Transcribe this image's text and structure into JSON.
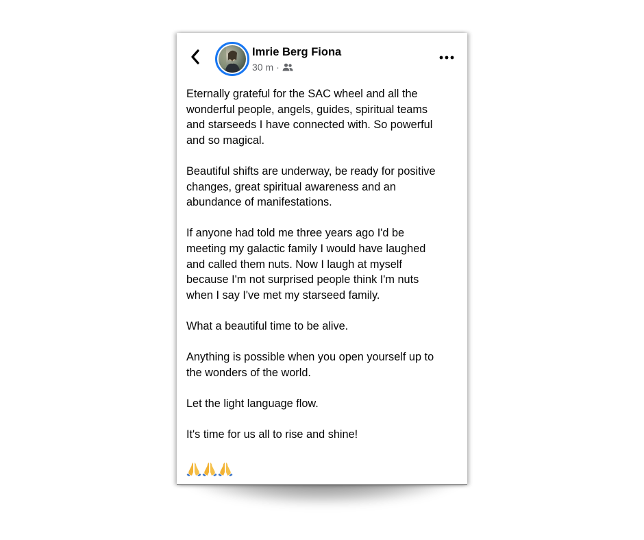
{
  "post": {
    "author_name": "Imrie Berg Fiona",
    "timestamp": "30 m",
    "separator": "·",
    "audience_icon": "friends-icon",
    "paragraphs": [
      "Eternally grateful for the SAC wheel and all the\nwonderful people, angels, guides, spiritual teams\nand starseeds I have connected with. So powerful\nand so magical.",
      "Beautiful shifts are underway, be ready for positive\nchanges, great spiritual awareness and an\nabundance of manifestations.",
      "If anyone had told me three years ago I'd be\nmeeting my galactic family I would have laughed\nand called them nuts. Now I laugh at myself\nbecause I'm not surprised people think I'm nuts\nwhen I say I've met my starseed family.",
      "What a beautiful time to be alive.",
      "Anything is possible when you open yourself up to\nthe wonders of the world.",
      "Let the light language flow.",
      "It's time for us all to rise and shine!"
    ],
    "emoji": [
      "🙏",
      "🙏",
      "🙏"
    ]
  },
  "icons": {
    "back": "chevron-left-icon",
    "more": "more-horizontal-icon"
  },
  "colors": {
    "avatar_ring": "#1877f2",
    "text_primary": "#050505",
    "text_secondary": "#65676b"
  }
}
